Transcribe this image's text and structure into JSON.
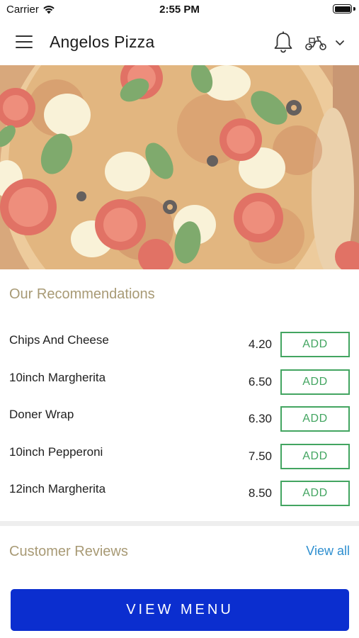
{
  "status_bar": {
    "carrier": "Carrier",
    "time": "2:55 PM",
    "wifi_icon": "wifi-icon",
    "battery_icon": "battery-icon"
  },
  "header": {
    "title": "Angelos Pizza",
    "menu_icon": "hamburger-icon",
    "notification_icon": "bell-icon",
    "delivery_icon": "scooter-icon",
    "dropdown_icon": "chevron-down-icon"
  },
  "hero": {
    "image": "pizza-photo"
  },
  "recommendations": {
    "title": "Our Recommendations",
    "add_label": "ADD",
    "items": [
      {
        "name": "Chips And Cheese",
        "price": "4.20"
      },
      {
        "name": "10inch Margherita",
        "price": "6.50"
      },
      {
        "name": "Doner Wrap",
        "price": "6.30"
      },
      {
        "name": "10inch Pepperoni",
        "price": "7.50"
      },
      {
        "name": "12inch Margherita",
        "price": "8.50"
      }
    ]
  },
  "reviews": {
    "title": "Customer Reviews",
    "view_all": "View all"
  },
  "footer": {
    "view_menu": "VIEW MENU"
  },
  "colors": {
    "accent_green": "#43a561",
    "section_title": "#a89a75",
    "link_blue": "#2e8fd0",
    "primary_button": "#0b2ecf"
  }
}
